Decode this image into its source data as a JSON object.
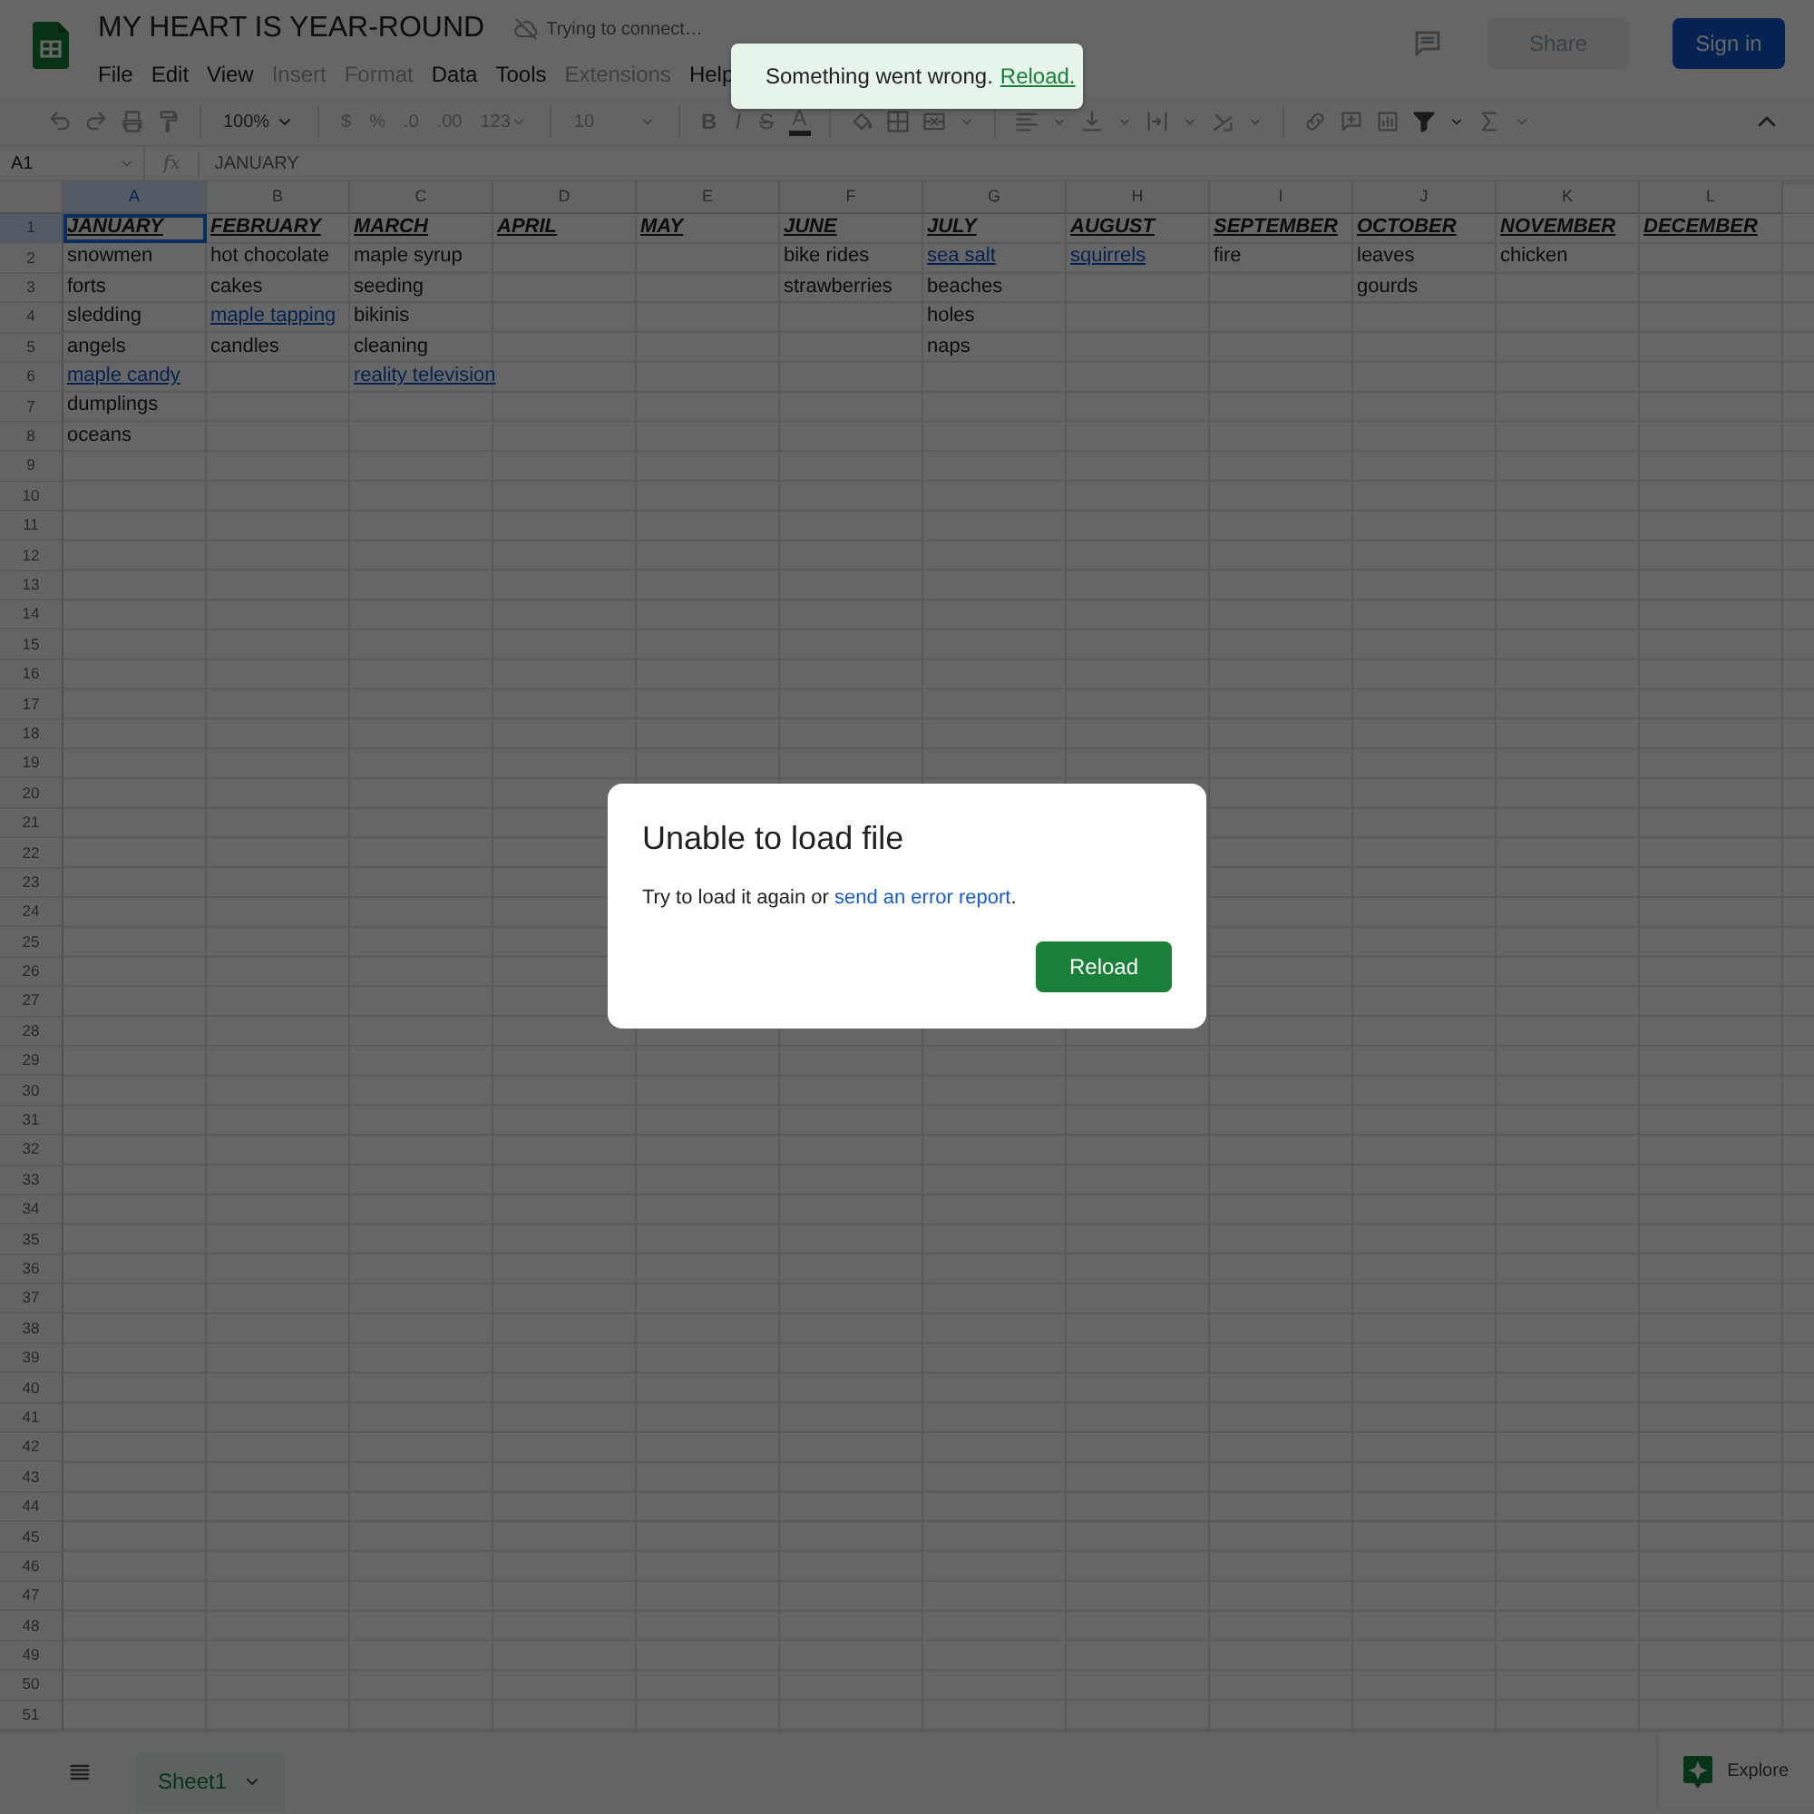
{
  "doc": {
    "title": "MY HEART IS YEAR-ROUND",
    "status": "Trying to connect…"
  },
  "menus": [
    {
      "label": "File",
      "disabled": false
    },
    {
      "label": "Edit",
      "disabled": false
    },
    {
      "label": "View",
      "disabled": false
    },
    {
      "label": "Insert",
      "disabled": true
    },
    {
      "label": "Format",
      "disabled": true
    },
    {
      "label": "Data",
      "disabled": false
    },
    {
      "label": "Tools",
      "disabled": false
    },
    {
      "label": "Extensions",
      "disabled": true
    },
    {
      "label": "Help",
      "disabled": false
    }
  ],
  "header_buttons": {
    "share": {
      "label": "Share",
      "disabled": true
    },
    "sign_in": {
      "label": "Sign in",
      "disabled": false
    }
  },
  "toolbar": {
    "zoom": "100%",
    "currency": "$",
    "percent": "%",
    "decimal_decrease": ".0",
    "decimal_increase": ".00",
    "number_format": "123",
    "font_size": "10",
    "bold": "B",
    "italic": "I",
    "strikethrough": "S",
    "text_color": "A"
  },
  "formula_bar": {
    "cell_ref": "A1",
    "fx": "fx",
    "value": "JANUARY"
  },
  "columns": [
    {
      "label": "A",
      "selected": true
    },
    {
      "label": "B",
      "selected": false
    },
    {
      "label": "C",
      "selected": false
    },
    {
      "label": "D",
      "selected": false
    },
    {
      "label": "E",
      "selected": false
    },
    {
      "label": "F",
      "selected": false
    },
    {
      "label": "G",
      "selected": false
    },
    {
      "label": "H",
      "selected": false
    },
    {
      "label": "I",
      "selected": false
    },
    {
      "label": "J",
      "selected": false
    },
    {
      "label": "K",
      "selected": false
    },
    {
      "label": "L",
      "selected": false
    }
  ],
  "row_numbers": [
    {
      "label": "1",
      "selected": true
    },
    {
      "label": "2",
      "selected": false
    },
    {
      "label": "3",
      "selected": false
    },
    {
      "label": "4",
      "selected": false
    },
    {
      "label": "5",
      "selected": false
    },
    {
      "label": "6",
      "selected": false
    },
    {
      "label": "7",
      "selected": false
    },
    {
      "label": "8",
      "selected": false
    },
    {
      "label": "9",
      "selected": false
    },
    {
      "label": "10",
      "selected": false
    },
    {
      "label": "11",
      "selected": false
    },
    {
      "label": "12",
      "selected": false
    },
    {
      "label": "13",
      "selected": false
    },
    {
      "label": "14",
      "selected": false
    },
    {
      "label": "15",
      "selected": false
    },
    {
      "label": "16",
      "selected": false
    },
    {
      "label": "17",
      "selected": false
    },
    {
      "label": "18",
      "selected": false
    },
    {
      "label": "19",
      "selected": false
    },
    {
      "label": "20",
      "selected": false
    },
    {
      "label": "21",
      "selected": false
    },
    {
      "label": "22",
      "selected": false
    },
    {
      "label": "23",
      "selected": false
    },
    {
      "label": "24",
      "selected": false
    },
    {
      "label": "25",
      "selected": false
    },
    {
      "label": "26",
      "selected": false
    },
    {
      "label": "27",
      "selected": false
    },
    {
      "label": "28",
      "selected": false
    },
    {
      "label": "29",
      "selected": false
    },
    {
      "label": "30",
      "selected": false
    },
    {
      "label": "31",
      "selected": false
    },
    {
      "label": "32",
      "selected": false
    },
    {
      "label": "33",
      "selected": false
    },
    {
      "label": "34",
      "selected": false
    },
    {
      "label": "35",
      "selected": false
    },
    {
      "label": "36",
      "selected": false
    },
    {
      "label": "37",
      "selected": false
    },
    {
      "label": "38",
      "selected": false
    },
    {
      "label": "39",
      "selected": false
    },
    {
      "label": "40",
      "selected": false
    },
    {
      "label": "41",
      "selected": false
    },
    {
      "label": "42",
      "selected": false
    },
    {
      "label": "43",
      "selected": false
    },
    {
      "label": "44",
      "selected": false
    },
    {
      "label": "45",
      "selected": false
    },
    {
      "label": "46",
      "selected": false
    },
    {
      "label": "47",
      "selected": false
    },
    {
      "label": "48",
      "selected": false
    },
    {
      "label": "49",
      "selected": false
    },
    {
      "label": "50",
      "selected": false
    },
    {
      "label": "51",
      "selected": false
    }
  ],
  "rows": [
    [
      {
        "text": "JANUARY",
        "kind": "heading",
        "selected": true
      },
      {
        "text": "FEBRUARY",
        "kind": "heading",
        "selected": false
      },
      {
        "text": "MARCH",
        "kind": "heading",
        "selected": false
      },
      {
        "text": "APRIL",
        "kind": "heading",
        "selected": false
      },
      {
        "text": "MAY",
        "kind": "heading",
        "selected": false
      },
      {
        "text": "JUNE",
        "kind": "heading",
        "selected": false
      },
      {
        "text": "JULY",
        "kind": "heading",
        "selected": false
      },
      {
        "text": "AUGUST",
        "kind": "heading",
        "selected": false
      },
      {
        "text": "SEPTEMBER",
        "kind": "heading",
        "selected": false
      },
      {
        "text": "OCTOBER",
        "kind": "heading",
        "selected": false
      },
      {
        "text": "NOVEMBER",
        "kind": "heading",
        "selected": false
      },
      {
        "text": "DECEMBER",
        "kind": "heading",
        "selected": false
      }
    ],
    [
      {
        "text": "snowmen",
        "kind": "plain",
        "selected": false
      },
      {
        "text": "hot chocolate",
        "kind": "plain",
        "selected": false
      },
      {
        "text": "maple syrup",
        "kind": "plain",
        "selected": false
      },
      null,
      null,
      {
        "text": "bike rides",
        "kind": "plain",
        "selected": false
      },
      {
        "text": "sea salt",
        "kind": "link",
        "selected": false
      },
      {
        "text": "squirrels",
        "kind": "link",
        "selected": false
      },
      {
        "text": "fire",
        "kind": "plain",
        "selected": false
      },
      {
        "text": "leaves",
        "kind": "plain",
        "selected": false
      },
      {
        "text": "chicken",
        "kind": "plain",
        "selected": false
      },
      null
    ],
    [
      {
        "text": "forts",
        "kind": "plain",
        "selected": false
      },
      {
        "text": "cakes",
        "kind": "plain",
        "selected": false
      },
      {
        "text": "seeding",
        "kind": "plain",
        "selected": false
      },
      null,
      null,
      {
        "text": "strawberries",
        "kind": "plain",
        "selected": false
      },
      {
        "text": "beaches",
        "kind": "plain",
        "selected": false
      },
      null,
      null,
      {
        "text": "gourds",
        "kind": "plain",
        "selected": false
      },
      null,
      null
    ],
    [
      {
        "text": "sledding",
        "kind": "plain",
        "selected": false
      },
      {
        "text": "maple tapping",
        "kind": "link",
        "selected": false
      },
      {
        "text": "bikinis",
        "kind": "plain",
        "selected": false
      },
      null,
      null,
      null,
      {
        "text": "holes",
        "kind": "plain",
        "selected": false
      },
      null,
      null,
      null,
      null,
      null
    ],
    [
      {
        "text": "angels",
        "kind": "plain",
        "selected": false
      },
      {
        "text": "candles",
        "kind": "plain",
        "selected": false
      },
      {
        "text": "cleaning",
        "kind": "plain",
        "selected": false
      },
      null,
      null,
      null,
      {
        "text": "naps",
        "kind": "plain",
        "selected": false
      },
      null,
      null,
      null,
      null,
      null
    ],
    [
      {
        "text": "maple candy",
        "kind": "link",
        "selected": false
      },
      null,
      {
        "text": "reality television",
        "kind": "link",
        "selected": false
      },
      null,
      null,
      null,
      null,
      null,
      null,
      null,
      null,
      null
    ],
    [
      {
        "text": "dumplings",
        "kind": "plain",
        "selected": false
      },
      null,
      null,
      null,
      null,
      null,
      null,
      null,
      null,
      null,
      null,
      null
    ],
    [
      {
        "text": "oceans",
        "kind": "plain",
        "selected": false
      },
      null,
      null,
      null,
      null,
      null,
      null,
      null,
      null,
      null,
      null,
      null
    ]
  ],
  "sheet_tabs": [
    {
      "label": "Sheet1",
      "selected": true
    }
  ],
  "explore": "Explore",
  "toast": {
    "message": "Something went wrong.",
    "action": "Reload."
  },
  "dialog": {
    "title": "Unable to load file",
    "text": "Try to load it again or ",
    "link": "send an error report",
    "suffix": ".",
    "button": "Reload"
  }
}
